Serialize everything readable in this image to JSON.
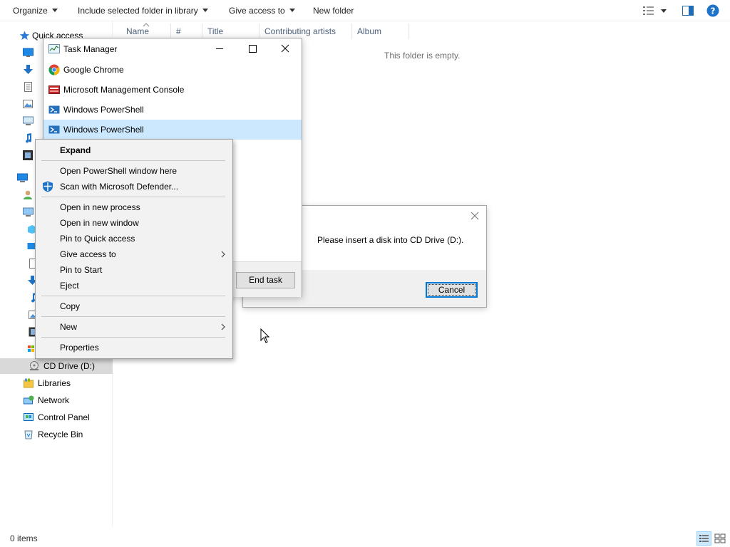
{
  "toolbar": {
    "organize": "Organize",
    "include_library": "Include selected folder in library",
    "give_access": "Give access to",
    "new_folder": "New folder"
  },
  "columns": {
    "name": "Name",
    "number": "#",
    "title": "Title",
    "contributing_artists": "Contributing artists",
    "album": "Album"
  },
  "main": {
    "empty_message": "This folder is empty."
  },
  "nav": {
    "quick_access": "Quick access",
    "cd_drive": "CD Drive (D:)",
    "libraries": "Libraries",
    "network": "Network",
    "control_panel": "Control Panel",
    "recycle_bin": "Recycle Bin"
  },
  "status": {
    "items": "0 items"
  },
  "task_manager": {
    "title": "Task Manager",
    "items": [
      "Google Chrome",
      "Microsoft Management Console",
      "Windows PowerShell",
      "Windows PowerShell"
    ],
    "end_task": "End task"
  },
  "dialog": {
    "message": "Please insert a disk into CD Drive (D:).",
    "cancel": "Cancel"
  },
  "context_menu": {
    "expand": "Expand",
    "open_powershell": "Open PowerShell window here",
    "scan_defender": "Scan with Microsoft Defender...",
    "open_new_process": "Open in new process",
    "open_new_window": "Open in new window",
    "pin_quick_access": "Pin to Quick access",
    "give_access": "Give access to",
    "pin_start": "Pin to Start",
    "eject": "Eject",
    "copy": "Copy",
    "new": "New",
    "properties": "Properties"
  },
  "colors": {
    "accent": "#0078d7",
    "selection": "#cce8ff",
    "menu_bg": "#f2f2f2"
  }
}
